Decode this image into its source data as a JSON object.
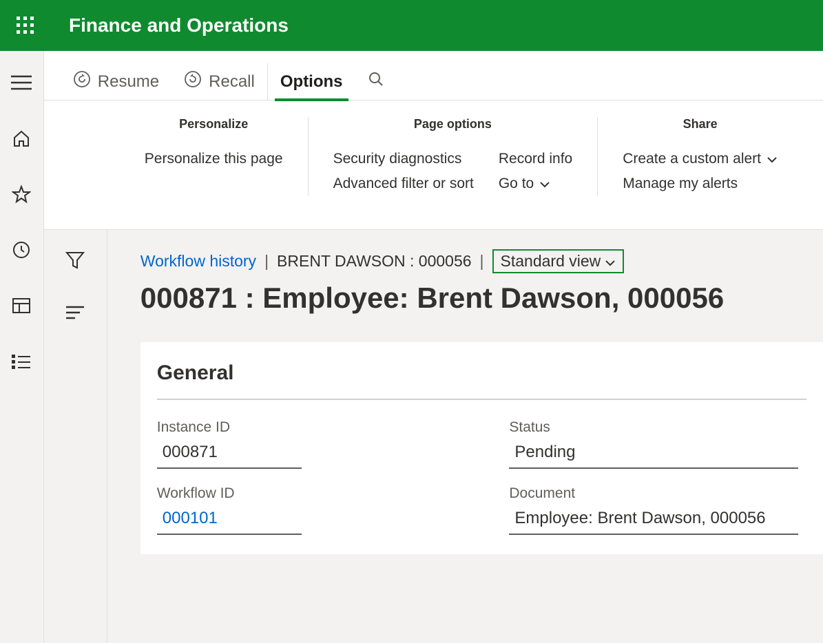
{
  "app_title": "Finance and Operations",
  "actionbar": {
    "resume": "Resume",
    "recall": "Recall",
    "options": "Options"
  },
  "options_panel": {
    "personalize": {
      "title": "Personalize",
      "personalize_page": "Personalize this page"
    },
    "page_options": {
      "title": "Page options",
      "security_diagnostics": "Security diagnostics",
      "advanced_filter": "Advanced filter or sort",
      "record_info": "Record info",
      "go_to": "Go to"
    },
    "share": {
      "title": "Share",
      "create_alert": "Create a custom alert",
      "manage_alerts": "Manage my alerts"
    }
  },
  "breadcrumb": {
    "link": "Workflow history",
    "record": "BRENT DAWSON : 000056",
    "view": "Standard view"
  },
  "page_title": "000871 : Employee: Brent Dawson, 000056",
  "card": {
    "title": "General",
    "instance_id_label": "Instance ID",
    "instance_id_value": "000871",
    "workflow_id_label": "Workflow ID",
    "workflow_id_value": "000101",
    "status_label": "Status",
    "status_value": "Pending",
    "document_label": "Document",
    "document_value": "Employee: Brent Dawson, 000056"
  }
}
